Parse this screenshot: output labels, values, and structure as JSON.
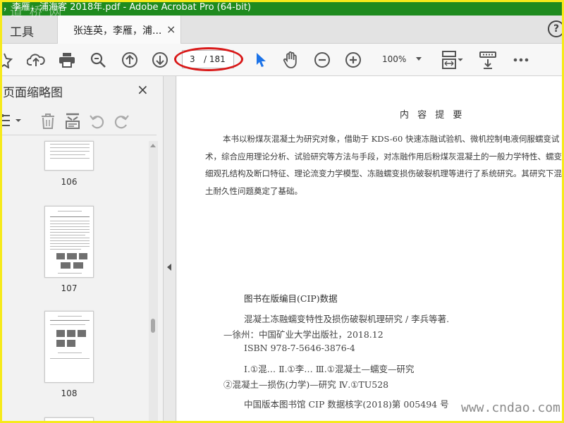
{
  "window": {
    "title": "，李雁，浦海客 2018年.pdf - Adobe Acrobat Pro (64-bit)",
    "watermark_top": "道 桥 网"
  },
  "tabs": {
    "tools_label": "工具",
    "doc_label": "张连英，李雁，浦...",
    "close_glyph": "×",
    "help_glyph": "?"
  },
  "toolbar": {
    "current_page": "3",
    "total_pages": "/ 181",
    "zoom": "100%"
  },
  "sidebar": {
    "title": "页面缩略图",
    "close_glyph": "×",
    "thumbnails": [
      {
        "label": "106"
      },
      {
        "label": "107"
      },
      {
        "label": "108"
      }
    ]
  },
  "document": {
    "heading": "内 容 提 要",
    "abstract": "本书以粉煤灰混凝土为研究对象，借助于 KDS-60 快速冻融试验机、微机控制电液伺服蠕变试术，综合应用理论分析、试验研究等方法与手段，对冻融作用后粉煤灰混凝土的一般力学特性、蠕变微细观孔结构及断口特征、理论流变力学模型、冻融蠕变损伤破裂机理等进行了系统研究。其研究下混凝土耐久性问题奠定了基础。",
    "cip_heading": "图书在版编目(CIP)数据",
    "cip_lines": [
      "混凝土冻融蠕变特性及损伤破裂机理研究 / 李兵等著.",
      "—徐州：中国矿业大学出版社，2018.12",
      "ISBN 978-7-5646-3876-4",
      "Ⅰ.①混…   Ⅱ.①李…   Ⅲ.①混凝土—蠕变—研究",
      "②混凝土—损伤(力学)—研究   Ⅳ.①TU528",
      "中国版本图书馆 CIP 数据核字(2018)第 005494 号"
    ]
  },
  "watermark_bottom": "www.cndao.com",
  "colors": {
    "title_bar": "#1f8b1f",
    "frame": "#f6ea1b",
    "annotation": "#d91818",
    "select_tool": "#1c73e8"
  }
}
